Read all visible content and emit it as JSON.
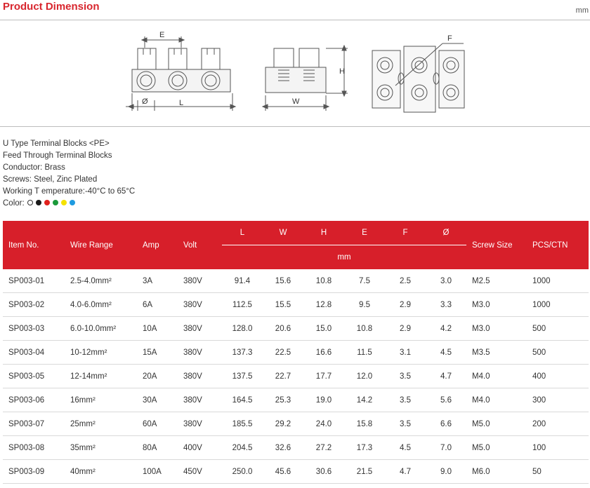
{
  "header": {
    "title": "Product Dimension",
    "unit": "mm"
  },
  "drawing_labels": {
    "E": "E",
    "diameter": "Ø",
    "L": "L",
    "H": "H",
    "W": "W",
    "F": "F"
  },
  "specs": {
    "line1": "U Type Terminal Blocks <PE>",
    "line2": "Feed Through Terminal Blocks",
    "line3": "Conductor: Brass",
    "line4": "Screws: Steel, Zinc Plated",
    "line5": "Working T emperature:-40°C to 65°C",
    "color_label": "Color:",
    "colors": [
      "#ffffff",
      "#1a1a1a",
      "#e0211d",
      "#1a9a3a",
      "#f5e200",
      "#1e9be0"
    ]
  },
  "table": {
    "headers": {
      "item": "Item No.",
      "wire": "Wire Range",
      "amp": "Amp",
      "volt": "Volt",
      "L": "L",
      "W": "W",
      "H": "H",
      "E": "E",
      "F": "F",
      "dia": "Ø",
      "mm": "mm",
      "screw": "Screw Size",
      "pcs": "PCS/CTN"
    },
    "rows": [
      [
        "SP003-01",
        "2.5-4.0mm²",
        "3A",
        "380V",
        "91.4",
        "15.6",
        "10.8",
        "7.5",
        "2.5",
        "3.0",
        "M2.5",
        "1000"
      ],
      [
        "SP003-02",
        "4.0-6.0mm²",
        "6A",
        "380V",
        "112.5",
        "15.5",
        "12.8",
        "9.5",
        "2.9",
        "3.3",
        "M3.0",
        "1000"
      ],
      [
        "SP003-03",
        "6.0-10.0mm²",
        "10A",
        "380V",
        "128.0",
        "20.6",
        "15.0",
        "10.8",
        "2.9",
        "4.2",
        "M3.0",
        "500"
      ],
      [
        "SP003-04",
        "10-12mm²",
        "15A",
        "380V",
        "137.3",
        "22.5",
        "16.6",
        "11.5",
        "3.1",
        "4.5",
        "M3.5",
        "500"
      ],
      [
        "SP003-05",
        "12-14mm²",
        "20A",
        "380V",
        "137.5",
        "22.7",
        "17.7",
        "12.0",
        "3.5",
        "4.7",
        "M4.0",
        "400"
      ],
      [
        "SP003-06",
        "16mm²",
        "30A",
        "380V",
        "164.5",
        "25.3",
        "19.0",
        "14.2",
        "3.5",
        "5.6",
        "M4.0",
        "300"
      ],
      [
        "SP003-07",
        "25mm²",
        "60A",
        "380V",
        "185.5",
        "29.2",
        "24.0",
        "15.8",
        "3.5",
        "6.6",
        "M5.0",
        "200"
      ],
      [
        "SP003-08",
        "35mm²",
        "80A",
        "400V",
        "204.5",
        "32.6",
        "27.2",
        "17.3",
        "4.5",
        "7.0",
        "M5.0",
        "100"
      ],
      [
        "SP003-09",
        "40mm²",
        "100A",
        "450V",
        "250.0",
        "45.6",
        "30.6",
        "21.5",
        "4.7",
        "9.0",
        "M6.0",
        "50"
      ]
    ]
  }
}
